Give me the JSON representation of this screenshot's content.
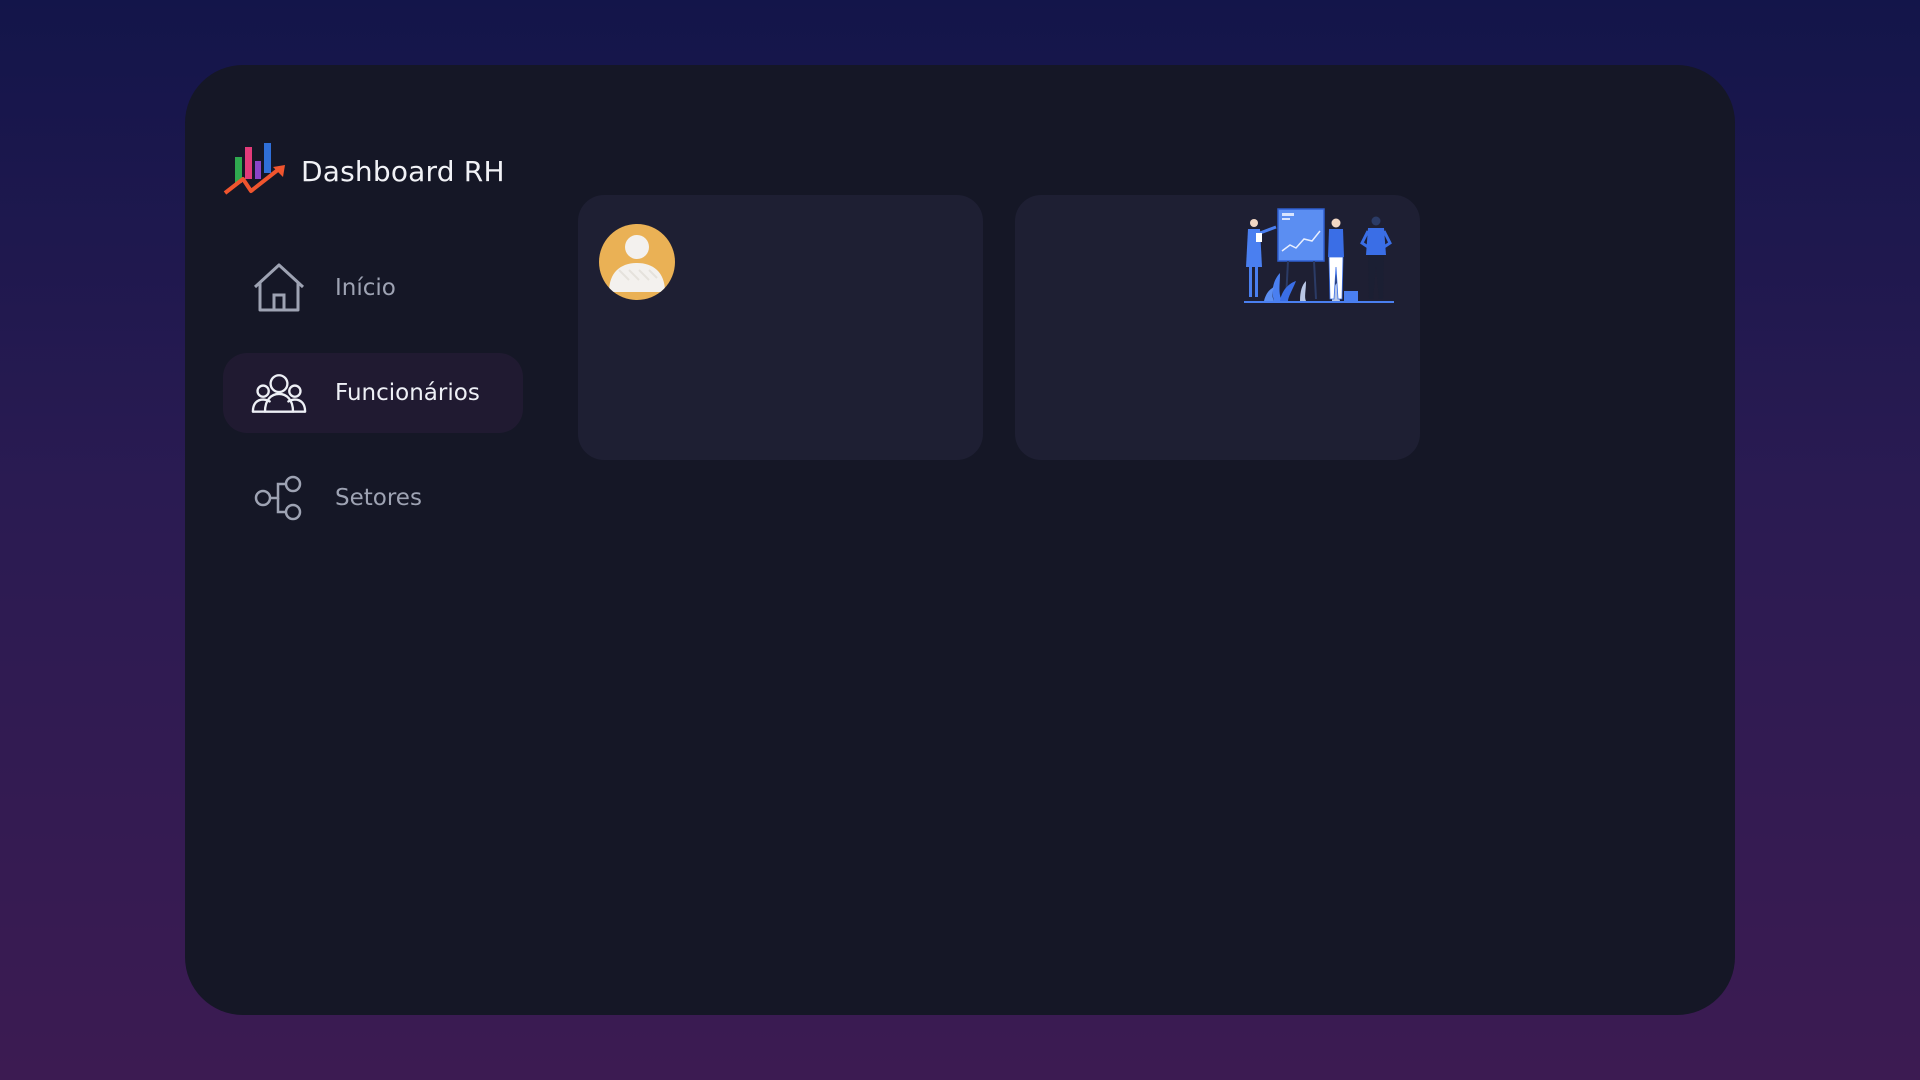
{
  "app": {
    "title": "Dashboard RH"
  },
  "sidebar": {
    "items": [
      {
        "label": "Início",
        "icon": "home-icon",
        "active": false
      },
      {
        "label": "Funcionários",
        "icon": "users-icon",
        "active": true
      },
      {
        "label": "Setores",
        "icon": "share-nodes-icon",
        "active": false
      }
    ]
  },
  "cards": [
    {
      "icon": "user-avatar-icon"
    },
    {
      "icon": "team-presentation-illustration"
    }
  ],
  "colors": {
    "background_top": "#13154a",
    "background_bottom": "#3c1b52",
    "window": "#151726",
    "card": "#1e1f33",
    "active_nav": "#201a31",
    "avatar": "#eab155",
    "illustration_accent": "#4a7ff0"
  }
}
